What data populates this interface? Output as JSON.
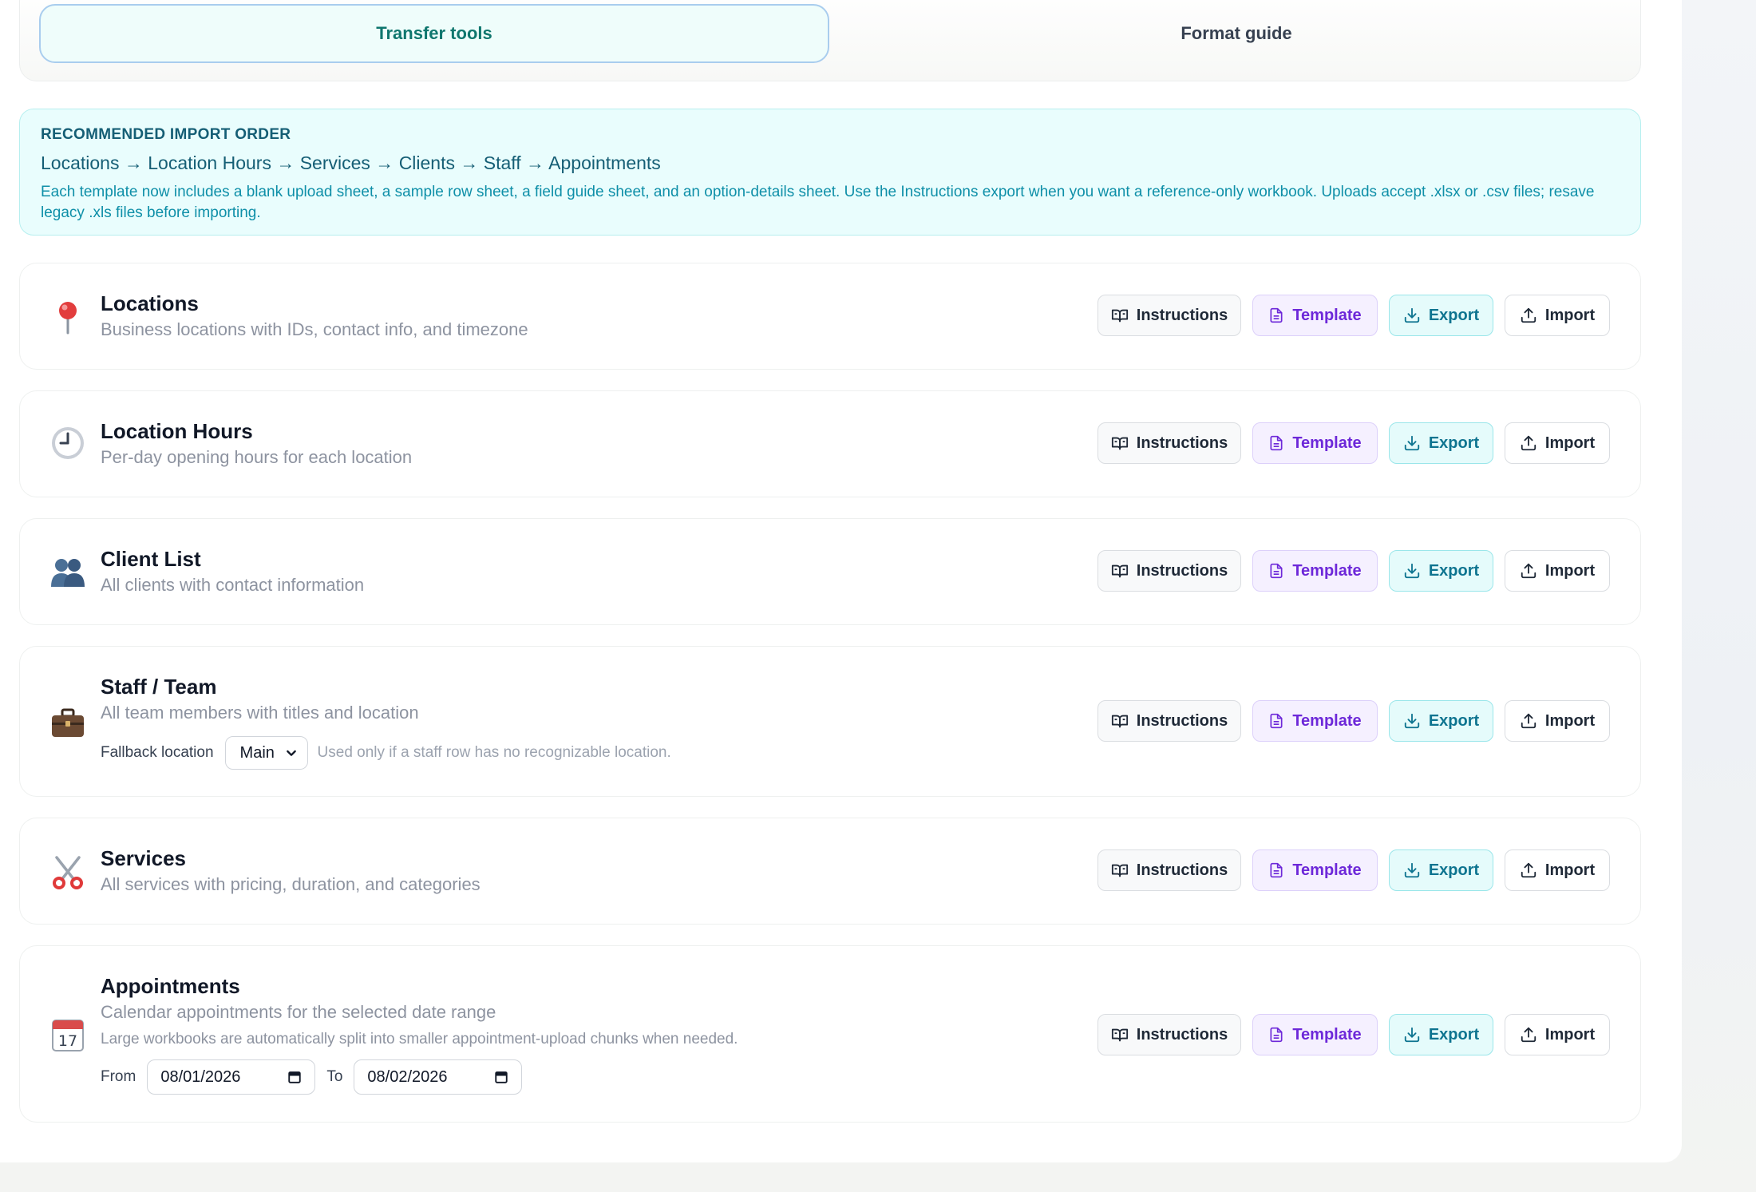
{
  "tabs": [
    {
      "label": "Transfer tools",
      "active": true
    },
    {
      "label": "Format guide",
      "active": false
    }
  ],
  "banner": {
    "title": "RECOMMENDED IMPORT ORDER",
    "order": "Locations → Location Hours → Services → Clients → Staff → Appointments",
    "description": "Each template now includes a blank upload sheet, a sample row sheet, a field guide sheet, and an option-details sheet. Use the Instructions export when you want a reference-only workbook. Uploads accept .xlsx or .csv files; resave legacy .xls files before importing."
  },
  "buttons": {
    "instructions": "Instructions",
    "template": "Template",
    "export": "Export",
    "import": "Import"
  },
  "cards": {
    "locations": {
      "icon": "round-pushpin-icon",
      "title": "Locations",
      "description": "Business locations with IDs, contact info, and timezone"
    },
    "location_hours": {
      "icon": "clock-icon",
      "title": "Location Hours",
      "description": "Per-day opening hours for each location"
    },
    "clients": {
      "icon": "people-icon",
      "title": "Client List",
      "description": "All clients with contact information"
    },
    "staff": {
      "icon": "briefcase-icon",
      "title": "Staff / Team",
      "description": "All team members with titles and location",
      "fallback_label": "Fallback location",
      "fallback_value": "Main",
      "fallback_hint": "Used only if a staff row has no recognizable location."
    },
    "services": {
      "icon": "scissors-icon",
      "title": "Services",
      "description": "All services with pricing, duration, and categories"
    },
    "appointments": {
      "icon": "calendar-icon",
      "title": "Appointments",
      "description": "Calendar appointments for the selected date range",
      "note": "Large workbooks are automatically split into smaller appointment-upload chunks when needed.",
      "from_label": "From",
      "from_value": "08/01/2026",
      "to_label": "To",
      "to_value": "08/02/2026",
      "calendar_day": "17"
    }
  },
  "colors": {
    "accent_teal": "#0f766e",
    "banner_bg": "#e9fdfd",
    "template_purple": "#6d28d9",
    "export_teal": "#0e7490"
  }
}
